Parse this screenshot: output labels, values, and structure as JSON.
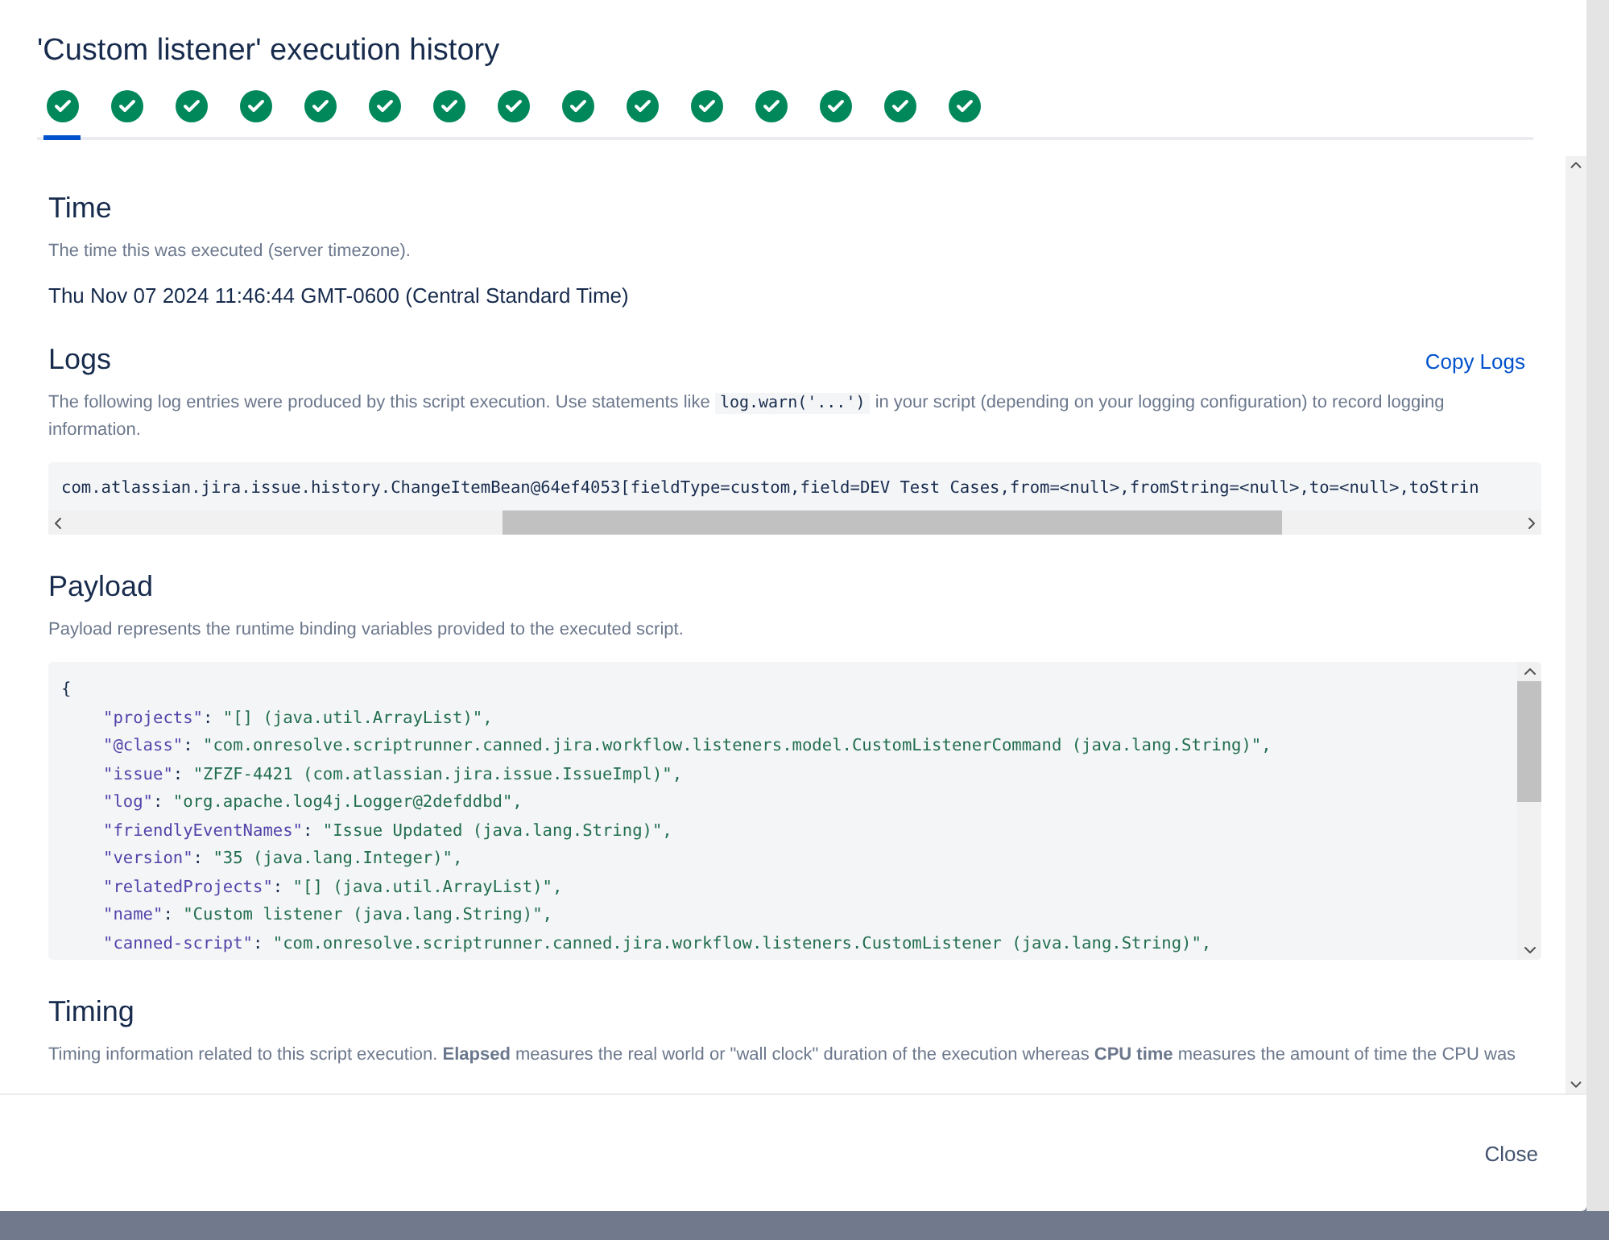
{
  "dialog": {
    "title": "'Custom listener' execution history"
  },
  "runs": [
    {
      "kind": "success",
      "selected": true
    },
    {
      "kind": "success",
      "selected": false
    },
    {
      "kind": "success",
      "selected": false
    },
    {
      "kind": "success",
      "selected": false
    },
    {
      "kind": "success",
      "selected": false
    },
    {
      "kind": "success",
      "selected": false
    },
    {
      "kind": "success",
      "selected": false
    },
    {
      "kind": "success",
      "selected": false
    },
    {
      "kind": "success",
      "selected": false
    },
    {
      "kind": "success",
      "selected": false
    },
    {
      "kind": "success",
      "selected": false
    },
    {
      "kind": "success",
      "selected": false
    },
    {
      "kind": "success",
      "selected": false
    },
    {
      "kind": "success",
      "selected": false
    },
    {
      "kind": "success",
      "selected": false
    }
  ],
  "time": {
    "heading": "Time",
    "description": "The time this was executed (server timezone).",
    "value": "Thu Nov 07 2024 11:46:44 GMT-0600 (Central Standard Time)"
  },
  "logs": {
    "heading": "Logs",
    "copy_link": "Copy Logs",
    "description_before": "The following log entries were produced by this script execution. Use statements like",
    "description_code": "log.warn('...')",
    "description_after": "in your script (depending on your logging configuration) to record logging information.",
    "entries": [
      "com.atlassian.jira.issue.history.ChangeItemBean@64ef4053[fieldType=custom,field=DEV Test Cases,from=<null>,fromString=<null>,to=<null>,toStrin"
    ]
  },
  "payload": {
    "heading": "Payload",
    "description": "Payload represents the runtime binding variables provided to the executed script.",
    "lines": [
      {
        "kind": "brace",
        "text": "{"
      },
      {
        "kind": "pair",
        "key": "\"projects\"",
        "sep": ": ",
        "value": "\"[] (java.util.ArrayList)\","
      },
      {
        "kind": "pair",
        "key": "\"@class\"",
        "sep": ": ",
        "value": "\"com.onresolve.scriptrunner.canned.jira.workflow.listeners.model.CustomListenerCommand (java.lang.String)\","
      },
      {
        "kind": "pair",
        "key": "\"issue\"",
        "sep": ": ",
        "value": "\"ZFZF-4421 (com.atlassian.jira.issue.IssueImpl)\","
      },
      {
        "kind": "pair",
        "key": "\"log\"",
        "sep": ": ",
        "value": "\"org.apache.log4j.Logger@2defddbd\","
      },
      {
        "kind": "pair",
        "key": "\"friendlyEventNames\"",
        "sep": ": ",
        "value": "\"Issue Updated (java.lang.String)\","
      },
      {
        "kind": "pair",
        "key": "\"version\"",
        "sep": ": ",
        "value": "\"35 (java.lang.Integer)\","
      },
      {
        "kind": "pair",
        "key": "\"relatedProjects\"",
        "sep": ": ",
        "value": "\"[] (java.util.ArrayList)\","
      },
      {
        "kind": "pair",
        "key": "\"name\"",
        "sep": ": ",
        "value": "\"Custom listener (java.lang.String)\","
      },
      {
        "kind": "pair",
        "key": "\"canned-script\"",
        "sep": ": ",
        "value": "\"com.onresolve.scriptrunner.canned.jira.workflow.listeners.CustomListener (java.lang.String)\","
      }
    ]
  },
  "timing": {
    "heading": "Timing",
    "description": "Timing information related to this script execution. **Elapsed** measures the real world or \"wall clock\" duration of the execution whereas **CPU time** measures the amount of time the CPU was"
  },
  "footer": {
    "close": "Close"
  }
}
